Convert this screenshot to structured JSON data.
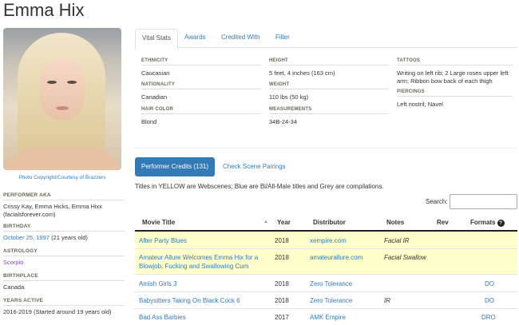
{
  "performer": {
    "name": "Emma Hix",
    "photo_credit": "Photo Copyright/Courtesy of Brazzers"
  },
  "sidebar": {
    "aka_label": "PERFORMER AKA",
    "aka_value": "Crissy Kay, Emma Hicks, Emma Hixx (facialsforever.com)",
    "birthday_label": "BIRTHDAY",
    "birthday_link": "October 25, 1997",
    "birthday_age": "(21 years old)",
    "astrology_label": "ASTROLOGY",
    "astrology_value": "Scorpio",
    "birthplace_label": "BIRTHPLACE",
    "birthplace_value": "Canada",
    "years_active_label": "YEARS ACTIVE",
    "years_active_value": "2016-2019 (Started around 19 years old)"
  },
  "tabs": [
    "Vital Stats",
    "Awards",
    "Credited With",
    "Filter"
  ],
  "vital_stats": {
    "ethnicity_label": "ETHNICITY",
    "ethnicity_value": "Caucasian",
    "nationality_label": "NATIONALITY",
    "nationality_value": "Canadian",
    "hair_label": "HAIR COLOR",
    "hair_value": "Blond",
    "height_label": "HEIGHT",
    "height_value": "5 feet, 4 inches (163 cm)",
    "weight_label": "WEIGHT",
    "weight_value": "110 lbs (50 kg)",
    "measurements_label": "MEASUREMENTS",
    "measurements_value": "34B-24-34",
    "tattoos_label": "TATTOOS",
    "tattoos_value": "Writing on left rib; 2 Large roses upper left arm; Ribbon bow back of each thigh",
    "piercings_label": "PIERCINGS",
    "piercings_value": "Left nostril; Navel"
  },
  "credits": {
    "button_label": "Performer Credits (131)",
    "pairings_label": "Check Scene Pairings",
    "legend_note": "Titles in YELLOW are Webscenes; Blue are Bi/All-Male titles and Grey are compilations.",
    "search_label": "Search:",
    "search_value": ""
  },
  "table": {
    "columns": [
      "Movie Title",
      "Year",
      "Distributor",
      "Notes",
      "Rev",
      "Formats"
    ],
    "sort_indicator": "▲",
    "formats_help_icon": "?",
    "rows": [
      {
        "title": "After Party Blues",
        "year": "2018",
        "distributor": "xempire.com",
        "notes": "Facial IR",
        "rev": "",
        "formats": "",
        "style": "yellow"
      },
      {
        "title": "Amateur Allure Welcomes Emma Hix for a Blowjob, Fucking and Swallowing Cum",
        "year": "2018",
        "distributor": "amateurallure.com",
        "notes": "Facial Swallow",
        "rev": "",
        "formats": "",
        "style": "yellow"
      },
      {
        "title": "Amish Girls 3",
        "year": "2018",
        "distributor": "Zero Tolerance",
        "notes": "",
        "rev": "",
        "formats": "DO",
        "style": "plain"
      },
      {
        "title": "Babysitters Taking On Black Cock 6",
        "year": "2018",
        "distributor": "Zero Tolerance",
        "notes": "IR",
        "rev": "",
        "formats": "DO",
        "style": "plain"
      },
      {
        "title": "Bad Ass Barbies",
        "year": "2017",
        "distributor": "AMK Empire",
        "notes": "",
        "rev": "",
        "formats": "DRO",
        "style": "plain"
      }
    ]
  }
}
